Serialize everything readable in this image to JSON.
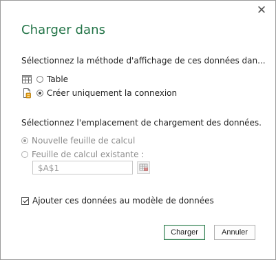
{
  "dialog": {
    "title": "Charger dans",
    "close_glyph": "✕"
  },
  "display_section": {
    "label": "Sélectionnez la méthode d'affichage de ces données dan...",
    "options": [
      {
        "label": "Table",
        "icon": "table-icon",
        "selected": false
      },
      {
        "label": "Créer uniquement la connexion",
        "icon": "connection-icon",
        "selected": true
      }
    ]
  },
  "location_section": {
    "label": "Sélectionnez l'emplacement de chargement des données.",
    "options": [
      {
        "label": "Nouvelle feuille de calcul",
        "selected": true,
        "disabled": true
      },
      {
        "label": "Feuille de calcul existante :",
        "selected": false,
        "disabled": true
      }
    ],
    "cell_reference": "$A$1",
    "ref_button_icon": "range-select-icon"
  },
  "data_model": {
    "label": "Ajouter ces données au modèle de données",
    "checked": true
  },
  "buttons": {
    "primary": "Charger",
    "secondary": "Annuler"
  },
  "colors": {
    "accent": "#217346",
    "disabled_text": "#8a8a8a"
  }
}
